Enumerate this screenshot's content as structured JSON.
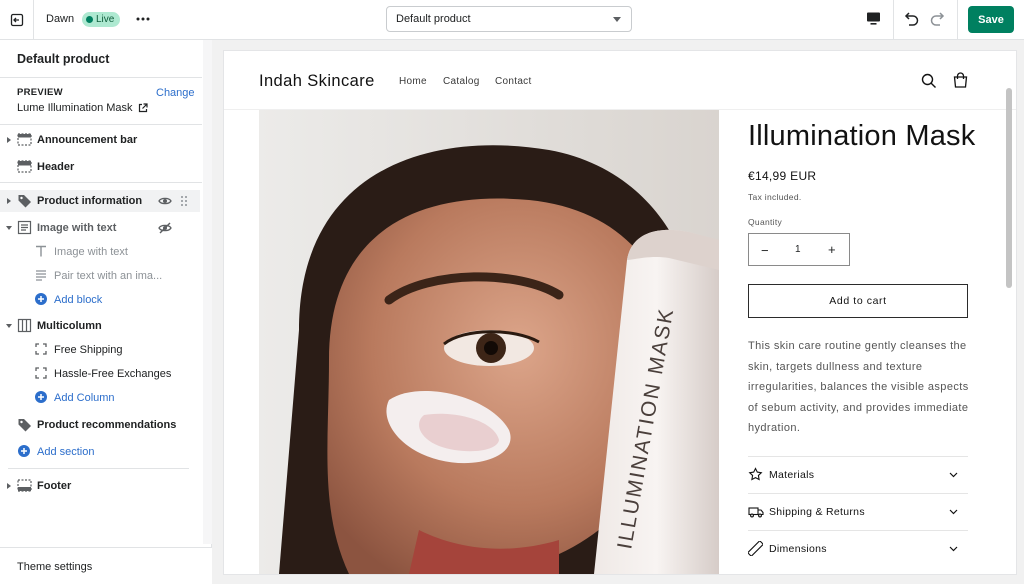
{
  "topbar": {
    "theme_name": "Dawn",
    "live_badge": "Live",
    "template_select": "Default product",
    "save_label": "Save"
  },
  "sidebar": {
    "title": "Default product",
    "preview_label": "PREVIEW",
    "change_label": "Change",
    "preview_product": "Lume Illumination Mask",
    "items": [
      {
        "label": "Announcement bar",
        "icon": "announcement-bar-icon"
      },
      {
        "label": "Header",
        "icon": "header-icon"
      },
      {
        "label": "Product information",
        "icon": "tag-icon"
      },
      {
        "label": "Image with text",
        "icon": "image-text-icon"
      },
      {
        "label": "Image with text",
        "icon": "text-icon"
      },
      {
        "label": "Pair text with an ima...",
        "icon": "paragraph-icon"
      },
      {
        "label": "Add block",
        "icon": "add-circle-icon"
      },
      {
        "label": "Multicolumn",
        "icon": "columns-icon"
      },
      {
        "label": "Free Shipping",
        "icon": "column-block-icon"
      },
      {
        "label": "Hassle-Free Exchanges",
        "icon": "column-block-icon"
      },
      {
        "label": "Add Column",
        "icon": "add-circle-icon"
      },
      {
        "label": "Product recommendations",
        "icon": "tag-icon"
      },
      {
        "label": "Add section",
        "icon": "add-circle-icon"
      },
      {
        "label": "Footer",
        "icon": "footer-icon"
      }
    ],
    "footer_label": "Theme settings"
  },
  "store": {
    "brand": "Indah Skincare",
    "nav": [
      "Home",
      "Catalog",
      "Contact"
    ],
    "product": {
      "title": "Illumination Mask",
      "price": "€14,99 EUR",
      "tax_note": "Tax included.",
      "quantity_label": "Quantity",
      "quantity": "1",
      "add_to_cart": "Add to cart",
      "description": "This skin care routine gently cleanses the skin, targets dullness and texture irregularities, balances the visible aspects of sebum activity, and provides immediate hydration.",
      "tube_text": "ILLUMINATION MASK",
      "accordions": [
        {
          "label": "Materials",
          "icon": "leaf-icon"
        },
        {
          "label": "Shipping & Returns",
          "icon": "truck-icon"
        },
        {
          "label": "Dimensions",
          "icon": "ruler-icon"
        }
      ]
    }
  }
}
